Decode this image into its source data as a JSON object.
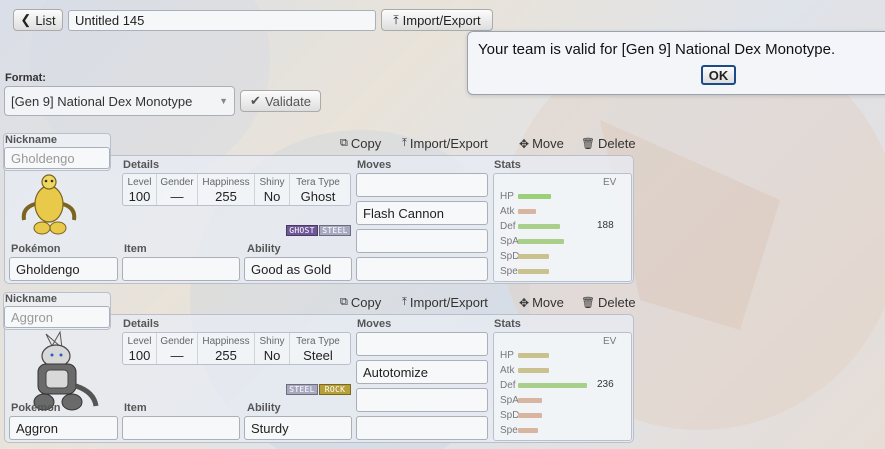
{
  "toolbar": {
    "list_label": "List",
    "team_name": "Untitled 145",
    "import_export_label": "Import/Export"
  },
  "popup": {
    "message": "Your team is valid for [Gen 9] National Dex Monotype.",
    "ok_label": "OK"
  },
  "format": {
    "label": "Format:",
    "value": "[Gen 9] National Dex Monotype",
    "validate_label": "Validate"
  },
  "set_labels": {
    "nickname": "Nickname",
    "details": "Details",
    "moves": "Moves",
    "stats": "Stats",
    "pokemon": "Pokémon",
    "item": "Item",
    "ability": "Ability",
    "level": "Level",
    "gender": "Gender",
    "happiness": "Happiness",
    "shiny": "Shiny",
    "tera_type": "Tera Type",
    "ev": "EV",
    "copy": "Copy",
    "import_export": "Import/Export",
    "move": "Move",
    "delete": "Delete"
  },
  "stat_names": [
    "HP",
    "Atk",
    "Def",
    "SpA",
    "SpD",
    "Spe"
  ],
  "sets": [
    {
      "nickname_placeholder": "Gholdengo",
      "level": "100",
      "gender": "—",
      "happiness": "255",
      "shiny": "No",
      "tera_type": "Ghost",
      "types": [
        "GHOST",
        "STEEL"
      ],
      "type_colors": [
        "#705898",
        "#a8a8c0"
      ],
      "moves": [
        "",
        "Flash Cannon",
        "",
        ""
      ],
      "pokemon": "Gholdengo",
      "item": "",
      "ability": "Good as Gold",
      "stat_bar_fraction": [
        0.38,
        0.2,
        0.48,
        0.52,
        0.35,
        0.35
      ],
      "stat_colors": [
        "#9ccf7a",
        "#d8b5a0",
        "#a8d08a",
        "#a8d08a",
        "#c9c28e",
        "#c9c28e"
      ],
      "evs": [
        "",
        "",
        "188",
        "",
        "",
        ""
      ]
    },
    {
      "nickname_placeholder": "Aggron",
      "level": "100",
      "gender": "—",
      "happiness": "255",
      "shiny": "No",
      "tera_type": "Steel",
      "types": [
        "STEEL",
        "ROCK"
      ],
      "type_colors": [
        "#a8a8c0",
        "#b8a038"
      ],
      "moves": [
        "",
        "Autotomize",
        "",
        ""
      ],
      "pokemon": "Aggron",
      "item": "",
      "ability": "Sturdy",
      "stat_bar_fraction": [
        0.35,
        0.35,
        0.78,
        0.27,
        0.27,
        0.23
      ],
      "stat_colors": [
        "#c9c28e",
        "#c9c28e",
        "#a8d08a",
        "#d8b5a0",
        "#d8b5a0",
        "#d8b5a0"
      ],
      "evs": [
        "",
        "",
        "236",
        "",
        "",
        ""
      ]
    }
  ]
}
